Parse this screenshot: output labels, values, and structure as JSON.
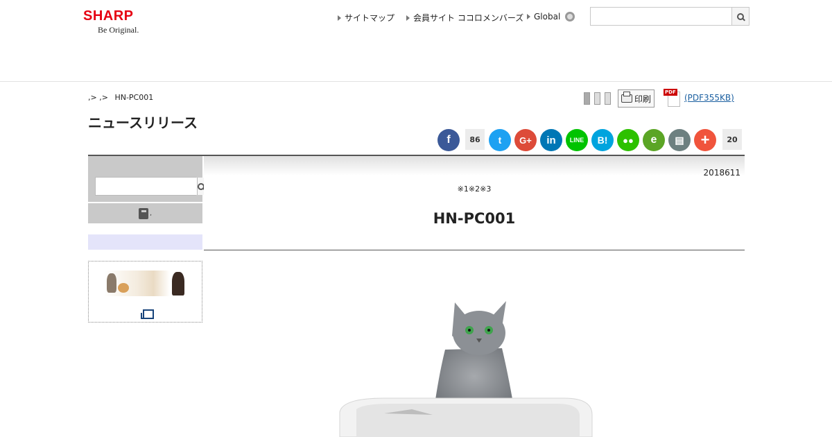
{
  "header": {
    "logo_word": "SHARP",
    "logo_tagline": "Be Original.",
    "nav": [
      {
        "label": "サイトマップ"
      },
      {
        "label": "会員サイト ココロメンバーズ"
      },
      {
        "label": "Global"
      }
    ],
    "search": {
      "value": "",
      "placeholder": ""
    }
  },
  "breadcrumb": {
    "separator_1": ",>",
    "separator_2": ",>",
    "current": "HN-PC001"
  },
  "page_title": "ニュースリリース",
  "tools": {
    "print_label": "印刷",
    "pdf_tag": "PDF",
    "pdf_label": "(PDF355KB)"
  },
  "share": {
    "facebook_count": "86",
    "total_count": "20",
    "hatena_glyph": "B!",
    "twitter_color": "#1da1f2",
    "facebook_color": "#3b5998",
    "gplus_color": "#dd4b39",
    "linkedin_color": "#0077b5",
    "line_color": "#00c300",
    "hatena_color": "#00a4de",
    "wechat_color": "#2dc100",
    "evernote_color": "#5ba525",
    "print_color": "#6d8080",
    "more_color": "#f0543c"
  },
  "sidebar": {
    "search": {
      "value": "",
      "placeholder": ""
    },
    "menu_suffix": ",",
    "banner_link_suffix": ","
  },
  "article": {
    "date": "2018611",
    "notes": "※1※2※3",
    "headline": "HN-PC001"
  }
}
